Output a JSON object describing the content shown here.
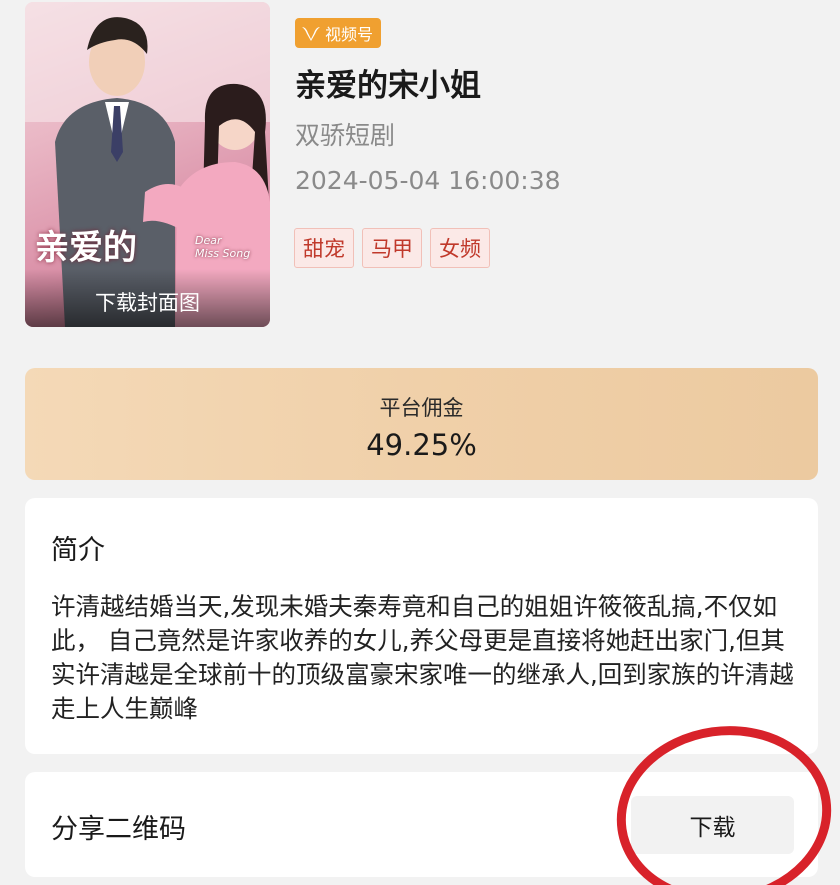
{
  "drama": {
    "platform_badge": "视频号",
    "title": "亲爱的宋小姐",
    "studio": "双骄短剧",
    "datetime": "2024-05-04 16:00:38",
    "tags": [
      "甜宠",
      "马甲",
      "女频"
    ],
    "cover": {
      "art_title": "亲爱的",
      "art_subtitle_en": "Dear\nMiss Song",
      "download_label": "下载封面图"
    }
  },
  "commission": {
    "label": "平台佣金",
    "value": "49.25%"
  },
  "intro": {
    "heading": "简介",
    "text": "许清越结婚当天,发现未婚夫秦寿竟和自己的姐姐许筱筱乱搞,不仅如此， 自己竟然是许家收养的女儿,养父母更是直接将她赶出家门,但其实许清越是全球前十的顶级富豪宋家唯一的继承人,回到家族的许清越走上人生巅峰"
  },
  "share_qr": {
    "label": "分享二维码",
    "download_button": "下载"
  },
  "colors": {
    "background": "#f2f2f2",
    "badge": "#f0a030",
    "tag_text": "#c0392b",
    "tag_bg": "#fbe9e7",
    "commission_bg": "#f0d0a9",
    "annotation_circle": "#d8222a"
  },
  "icons": {
    "platform": "channels-logo-icon"
  }
}
